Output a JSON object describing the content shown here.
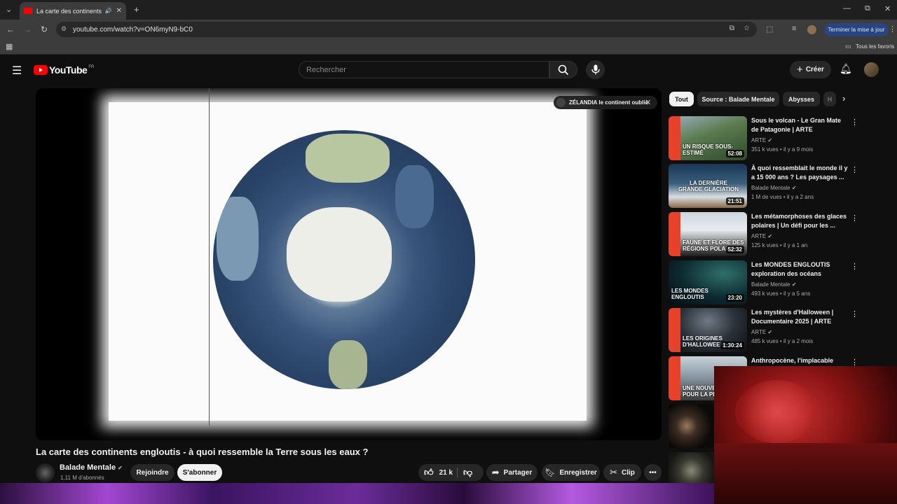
{
  "browser": {
    "tab_title": "La carte des continents eng",
    "url": "youtube.com/watch?v=ON6myN9-bC0",
    "update_button": "Terminer la mise à jour",
    "bookmarks_all": "Tous les favoris"
  },
  "header": {
    "logo_text": "YouTube",
    "logo_country": "FR",
    "search_placeholder": "Rechercher",
    "create_label": "Créer"
  },
  "player": {
    "chip_text": "ZÉLANDIA le continent oublié"
  },
  "video": {
    "title": "La carte des continents engloutis - à quoi ressemble la Terre sous les eaux ?",
    "channel": "Balade Mentale",
    "subscribers": "1,11 M d'abonnés",
    "join_label": "Rejoindre",
    "subscribe_label": "S'abonner",
    "likes": "21 k",
    "share_label": "Partager",
    "save_label": "Enregistrer",
    "clip_label": "Clip"
  },
  "chips": [
    "Tout",
    "Source : Balade Mentale",
    "Abysses",
    "H"
  ],
  "recommendations": [
    {
      "title": "Sous le volcan - Le Gran Mate de Patagonie | ARTE",
      "channel": "ARTE",
      "views": "351 k vues",
      "age": "il y a 9 mois",
      "duration": "52:08",
      "thumb_text": "UN RISQUE SOUS-ESTIMÉ"
    },
    {
      "title": "À quoi ressemblait le monde il y a 15 000 ans ? Les paysages ...",
      "channel": "Balade Mentale",
      "views": "1 M de vues",
      "age": "il y a 2 ans",
      "duration": "21:51",
      "thumb_text": "LA DERNIÈRE GRANDE GLACIATION"
    },
    {
      "title": "Les métamorphoses des glaces polaires | Un défi pour les ...",
      "channel": "ARTE",
      "views": "125 k vues",
      "age": "il y a 1 an",
      "duration": "52:32",
      "thumb_text": "FAUNE ET FLORE DES RÉGIONS POLAIRES"
    },
    {
      "title": "Les MONDES ENGLOUTIS exploration des océans",
      "channel": "Balade Mentale",
      "views": "493 k vues",
      "age": "il y a 5 ans",
      "duration": "23:20",
      "thumb_text": "LES MONDES ENGLOUTIS"
    },
    {
      "title": "Les mystères d'Halloween | Documentaire 2025 | ARTE",
      "channel": "ARTE",
      "views": "485 k vues",
      "age": "il y a 2 mois",
      "duration": "1:30:24",
      "thumb_text": "LES ORIGINES D'HALLOWEEN"
    },
    {
      "title": "Anthropocène, l'implacable",
      "channel": "",
      "views": "",
      "age": "",
      "duration": "",
      "thumb_text": "UNE NOUVELLE ÈRE POUR LA PLANÈTE"
    }
  ]
}
